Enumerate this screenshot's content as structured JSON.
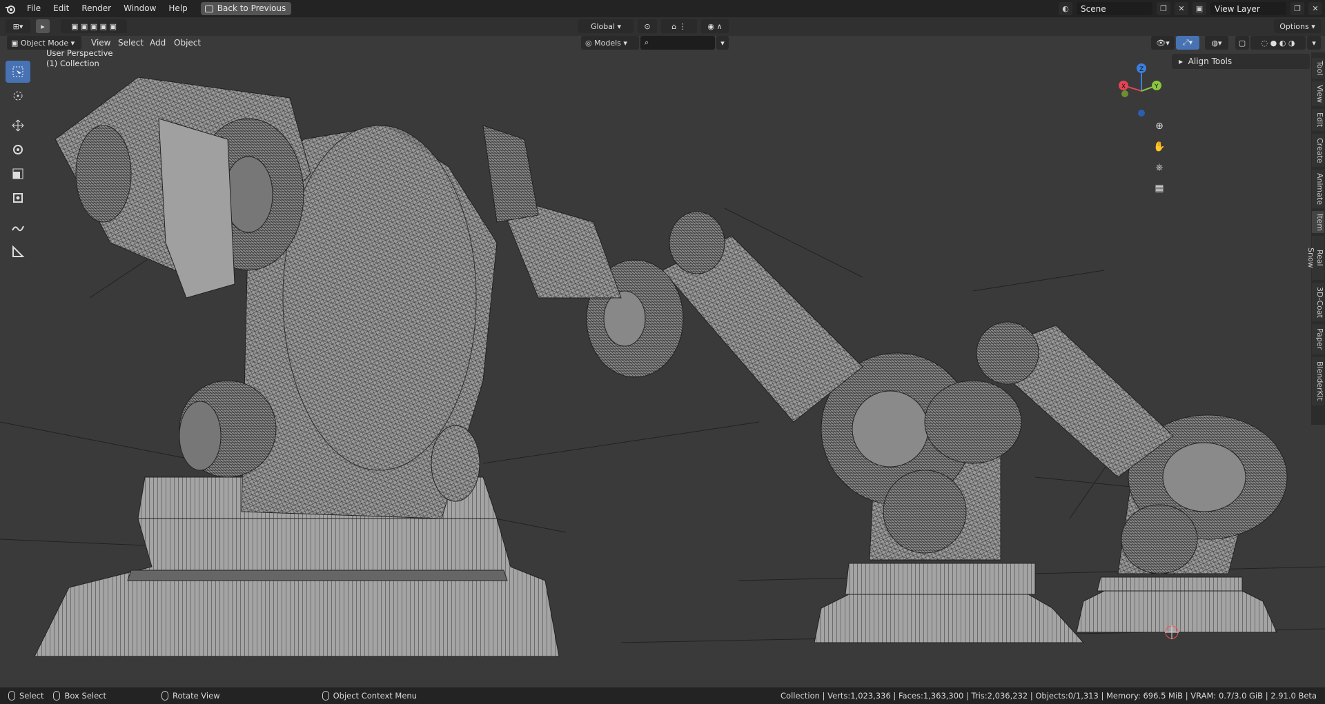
{
  "topbar": {
    "menu": [
      "File",
      "Edit",
      "Render",
      "Window",
      "Help"
    ],
    "back_label": "Back to Previous",
    "scene_label": "Scene",
    "view_layer_label": "View Layer"
  },
  "header": {
    "mode_label": "Object Mode",
    "menu": [
      "View",
      "Select",
      "Add",
      "Object"
    ],
    "orientation_label": "Global",
    "collection_label": "Models",
    "options_label": "Options",
    "search_placeholder": ""
  },
  "viewport": {
    "perspective_label": "User Perspective",
    "collection_label": "(1) Collection",
    "gizmo_axes": [
      "X",
      "Y",
      "Z"
    ]
  },
  "npanel": {
    "section_label": "Align Tools",
    "tabs": [
      "Tool",
      "View",
      "Edit",
      "Create",
      "Animate",
      "Item",
      "Real Snow",
      "3D-Coat",
      "Paper",
      "BlenderKit"
    ]
  },
  "statusbar": {
    "select_label": "Select",
    "box_select_label": "Box Select",
    "rotate_label": "Rotate View",
    "context_label": "Object Context Menu",
    "stats": "Collection | Verts:1,023,336 | Faces:1,363,300 | Tris:2,036,232 | Objects:0/1,313 | Memory: 696.5 MiB | VRAM: 0.7/3.0 GiB | 2.91.0 Beta"
  },
  "colors": {
    "accent": "#4772b3",
    "axis_x": "#e44556",
    "axis_y": "#8bc63f",
    "axis_z": "#3b7fe0",
    "mesh": "#8f8f8f"
  }
}
